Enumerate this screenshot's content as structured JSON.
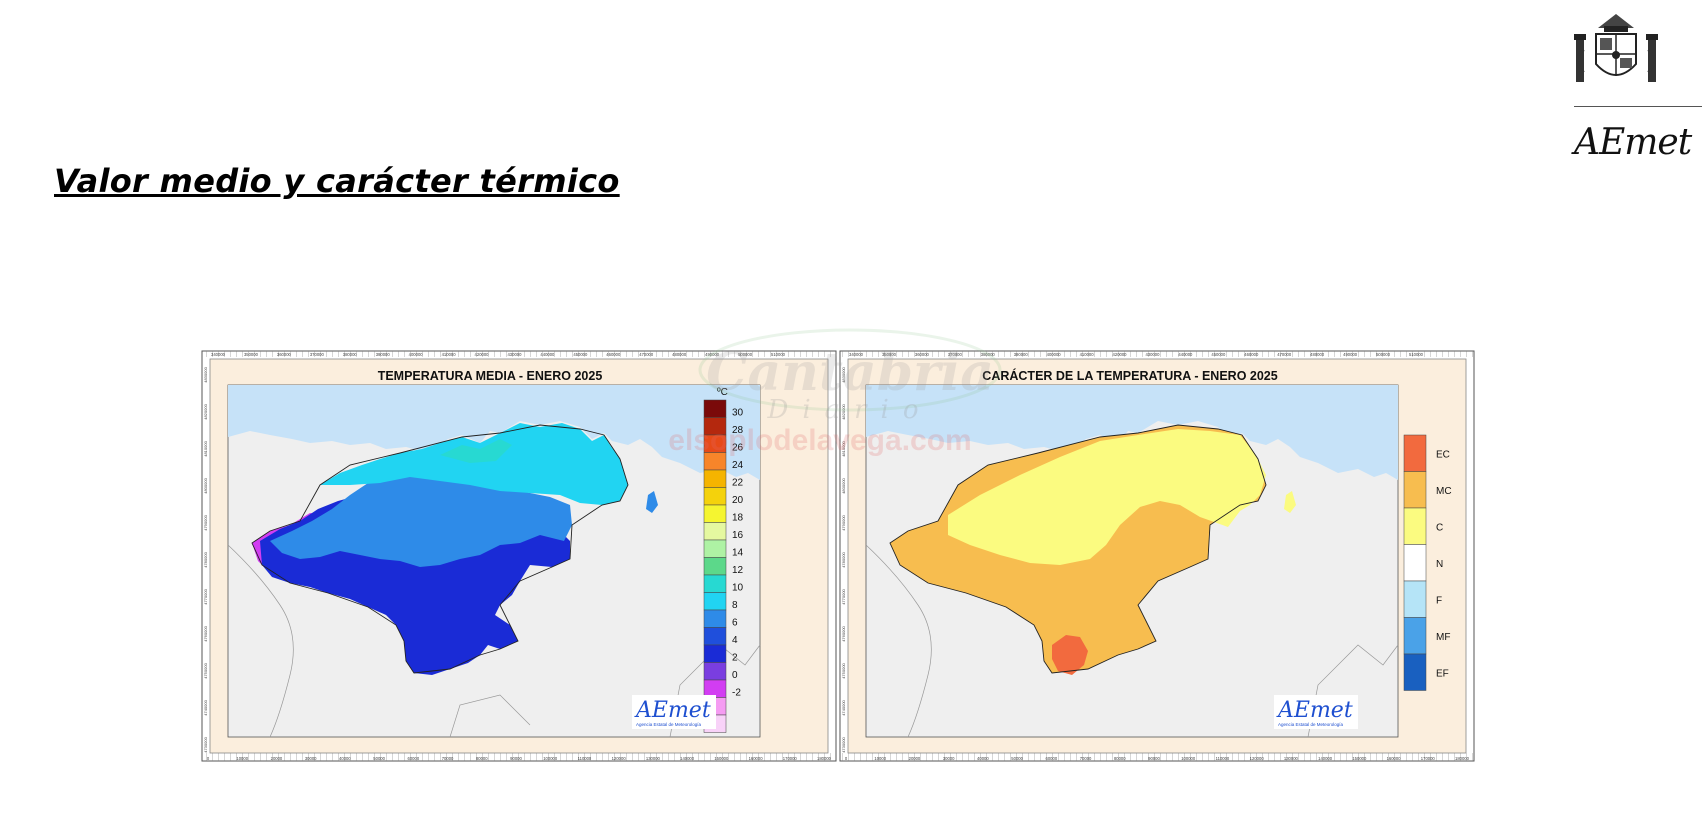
{
  "page": {
    "title": "Valor medio y carácter térmico",
    "logo_text": "AEmet"
  },
  "watermark": {
    "line1": "Cantabria",
    "line2": "Diario",
    "line3": "elsoplodelavega.com"
  },
  "map_left": {
    "title": "TEMPERATURA MEDIA - ENERO 2025",
    "unit": "ºC",
    "legend": [
      {
        "label": "30",
        "color": "#7a0a0a"
      },
      {
        "label": "28",
        "color": "#b4280e"
      },
      {
        "label": "26",
        "color": "#e64a19"
      },
      {
        "label": "24",
        "color": "#f7852a"
      },
      {
        "label": "22",
        "color": "#f5b400"
      },
      {
        "label": "20",
        "color": "#f4d20c"
      },
      {
        "label": "18",
        "color": "#f5f530"
      },
      {
        "label": "16",
        "color": "#e5f8a0"
      },
      {
        "label": "14",
        "color": "#aef2a4"
      },
      {
        "label": "12",
        "color": "#5cd88a"
      },
      {
        "label": "10",
        "color": "#27d9d2"
      },
      {
        "label": "8",
        "color": "#21d4f2"
      },
      {
        "label": "6",
        "color": "#2e8be8"
      },
      {
        "label": "4",
        "color": "#1f4fdc"
      },
      {
        "label": "2",
        "color": "#1a2bd6"
      },
      {
        "label": "0",
        "color": "#7a3ee0"
      },
      {
        "label": "-2",
        "color": "#d23df2"
      },
      {
        "label": "",
        "color": "#f59cf2"
      },
      {
        "label": "",
        "color": "#f8d2f8"
      }
    ],
    "logo": "AEmet",
    "logo_sub": "Agencia Estatal de Meteorología"
  },
  "map_right": {
    "title": "CARÁCTER DE LA TEMPERATURA - ENERO 2025",
    "legend": [
      {
        "label": "EC",
        "color": "#f26a3e"
      },
      {
        "label": "MC",
        "color": "#f7bd4f"
      },
      {
        "label": "C",
        "color": "#fbfb80"
      },
      {
        "label": "N",
        "color": "#ffffff"
      },
      {
        "label": "F",
        "color": "#b5e4f7"
      },
      {
        "label": "MF",
        "color": "#4aa2e8"
      },
      {
        "label": "EF",
        "color": "#1960c0"
      }
    ],
    "logo": "AEmet",
    "logo_sub": "Agencia Estatal de Meteorología"
  },
  "axis": {
    "top_ticks": [
      "340000",
      "350000",
      "360000",
      "370000",
      "380000",
      "390000",
      "400000",
      "410000",
      "420000",
      "430000",
      "440000",
      "450000",
      "460000",
      "470000",
      "480000",
      "490000",
      "500000",
      "510000"
    ],
    "bottom_ticks": [
      "0",
      "10000",
      "20000",
      "30000",
      "40000",
      "50000",
      "60000",
      "70000",
      "80000",
      "90000",
      "100000",
      "110000",
      "120000",
      "130000",
      "140000",
      "150000",
      "160000",
      "170000",
      "180000"
    ],
    "side_ticks": [
      "4830000",
      "4820000",
      "4810000",
      "4800000",
      "4790000",
      "4780000",
      "4770000",
      "4760000",
      "4750000",
      "4740000",
      "4730000"
    ]
  },
  "colors": {
    "sea": "#c6e2f8",
    "land_outside": "#efefef",
    "panel_bg": "#fbeedd",
    "border_line": "#666666"
  }
}
